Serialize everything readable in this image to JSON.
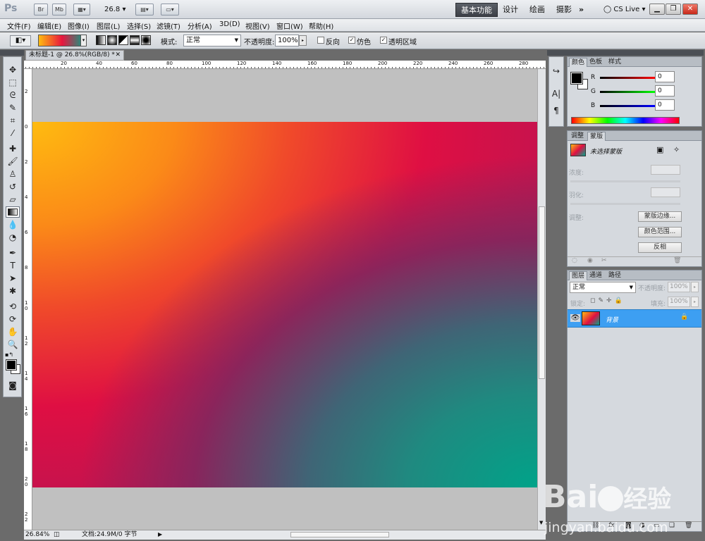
{
  "app": {
    "logo": "Ps",
    "mini_buttons": [
      "Br",
      "Mb"
    ],
    "zoom_value": "26.8",
    "workspaces": [
      "基本功能",
      "设计",
      "绘画",
      "摄影"
    ],
    "more_label": "»",
    "cs_live": "CS Live"
  },
  "menus": [
    "文件(F)",
    "编辑(E)",
    "图像(I)",
    "图层(L)",
    "选择(S)",
    "滤镜(T)",
    "分析(A)",
    "3D(D)",
    "视图(V)",
    "窗口(W)",
    "帮助(H)"
  ],
  "options": {
    "mode_label": "模式:",
    "mode_value": "正常",
    "opacity_label": "不透明度:",
    "opacity_value": "100%",
    "reverse_label": "反向",
    "dither_label": "仿色",
    "transparency_label": "透明区域",
    "reverse_checked": false,
    "dither_checked": true,
    "transparency_checked": true
  },
  "document": {
    "tab_title": "未标题-1 @ 26.8%(RGB/8) *",
    "ruler_top": [
      "20",
      "40",
      "60",
      "80",
      "100",
      "120",
      "140",
      "160",
      "180",
      "200",
      "220",
      "240",
      "260",
      "280"
    ],
    "ruler_left": [
      "2",
      "0",
      "2",
      "4",
      "6",
      "8",
      "1\n0",
      "1\n2",
      "1\n4",
      "1\n6",
      "1\n8",
      "2\n0",
      "2\n2"
    ],
    "status_zoom": "26.84%",
    "status_doc": "文档:24.9M/0 字节"
  },
  "color_panel": {
    "tabs": [
      "颜色",
      "色板",
      "样式"
    ],
    "r_label": "R",
    "g_label": "G",
    "b_label": "B",
    "r_value": "0",
    "g_value": "0",
    "b_value": "0"
  },
  "masks_panel": {
    "tabs": [
      "调整",
      "蒙版"
    ],
    "title": "未选择蒙版",
    "density_label": "浓度:",
    "feather_label": "羽化:",
    "refine_label": "调整:",
    "btn_edge": "蒙版边缘...",
    "btn_color_range": "颜色范围...",
    "btn_invert": "反相"
  },
  "layers_panel": {
    "tabs": [
      "图层",
      "通道",
      "路径"
    ],
    "blend_mode": "正常",
    "opacity_label": "不透明度:",
    "opacity_value": "100%",
    "lock_label": "锁定:",
    "fill_label": "填充:",
    "fill_value": "100%",
    "layer_name": "背景"
  },
  "watermark": {
    "brand_text": "Bai",
    "brand_text2": "经验",
    "url": "jingyan.baidu.com"
  },
  "colors": {
    "accent_blue": "#3d9ff2",
    "gradient_start": "#ffbb10",
    "gradient_mid": "#df0f43",
    "gradient_end": "#00a389"
  }
}
